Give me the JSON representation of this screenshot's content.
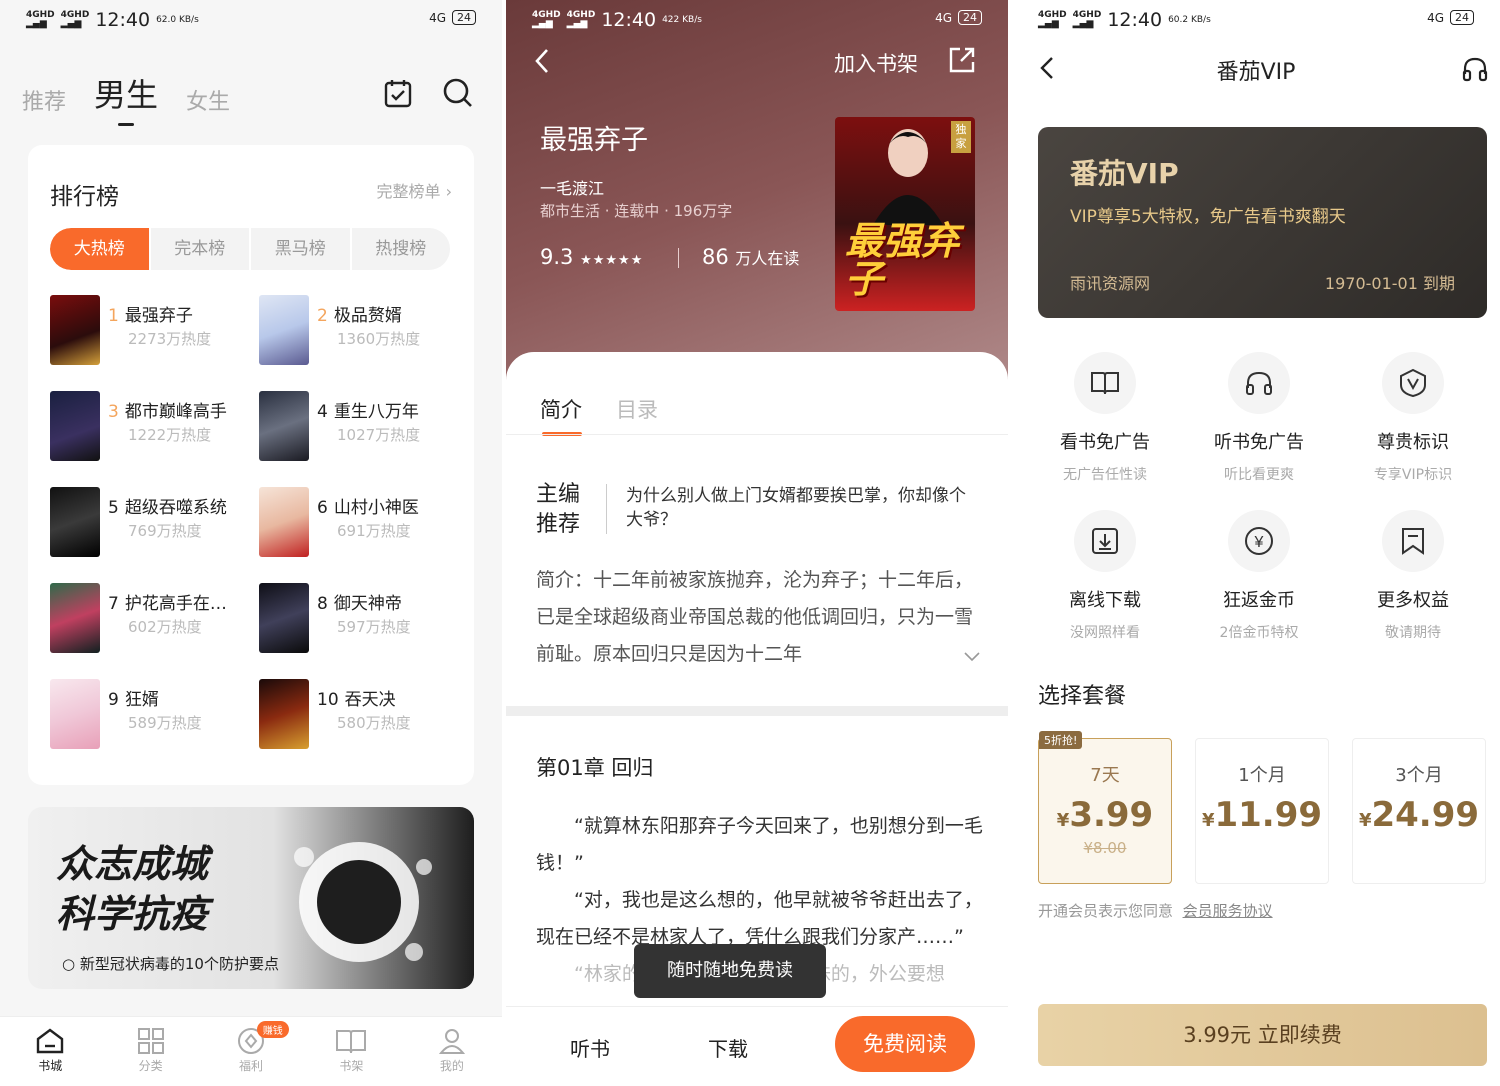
{
  "status_bars": [
    {
      "time": "12:40",
      "speed": "62.0 KB/s",
      "battery": "24",
      "net": "4G"
    },
    {
      "time": "12:40",
      "speed": "422 KB/s",
      "battery": "24",
      "net": "4G"
    },
    {
      "time": "12:40",
      "speed": "60.2 KB/s",
      "battery": "24",
      "net": "4G"
    }
  ],
  "store": {
    "tabs": [
      "推荐",
      "男生",
      "女生"
    ],
    "ranking": {
      "title": "排行榜",
      "more": "完整榜单 ›",
      "segments": [
        "大热榜",
        "完本榜",
        "黑马榜",
        "热搜榜"
      ],
      "items": [
        {
          "num": "1",
          "name": "最强弃子",
          "heat": "2273万热度"
        },
        {
          "num": "2",
          "name": "极品赘婿",
          "heat": "1360万热度"
        },
        {
          "num": "3",
          "name": "都市巅峰高手",
          "heat": "1222万热度"
        },
        {
          "num": "4",
          "name": "重生八万年",
          "heat": "1027万热度"
        },
        {
          "num": "5",
          "name": "超级吞噬系统",
          "heat": "769万热度"
        },
        {
          "num": "6",
          "name": "山村小神医",
          "heat": "691万热度"
        },
        {
          "num": "7",
          "name": "护花高手在…",
          "heat": "602万热度"
        },
        {
          "num": "8",
          "name": "御天神帝",
          "heat": "597万热度"
        },
        {
          "num": "9",
          "name": "狂婿",
          "heat": "589万热度"
        },
        {
          "num": "10",
          "name": "吞天决",
          "heat": "580万热度"
        }
      ]
    },
    "banner": {
      "line1": "众志成城",
      "line2": "科学抗疫",
      "sub": "新型冠状病毒的10个防护要点"
    },
    "tabbar": [
      "书城",
      "分类",
      "福利",
      "书架",
      "我的"
    ],
    "badge": "赚钱"
  },
  "book": {
    "add_shelf": "加入书架",
    "title": "最强弃子",
    "author": "一毛渡江",
    "meta": "都市生活 · 连载中 · 196万字",
    "score": "9.3",
    "stars": "★★★★★",
    "readers": "86",
    "readers_unit": "万人在读",
    "cover_title": "最强弃子",
    "cover_tag": "独家",
    "tabs": [
      "简介",
      "目录"
    ],
    "rec_label": "主编推荐",
    "rec_text": "为什么别人做上门女婿都要挨巴掌，你却像个大爷？",
    "intro": "简介：十二年前被家族抛弃，沦为弃子；十二年后，已是全球超级商业帝国总裁的他低调回归，只为一雪前耻。原本回归只是因为十二年",
    "chapter": "第01章 回归",
    "chapter_p1": "“就算林东阳那弃子今天回来了，也别想分到一毛钱！”",
    "chapter_p2": "“对，我也是这么想的，他早就被爷爷赶出去了，现在已经不是林家人了，凭什么跟我们分家产……”",
    "chapter_p3": "“林家的家产是我们王兄弟姐妹的，外公要想",
    "toast": "随时随地免费读",
    "listen": "听书",
    "download": "下载",
    "read": "免费阅读"
  },
  "vip": {
    "title": "番茄VIP",
    "card_title": "番茄VIP",
    "card_desc": "VIP尊享5大特权，免广告看书爽翻天",
    "card_source": "雨讯资源网",
    "card_expiry": "1970-01-01 到期",
    "perks": [
      {
        "name": "看书免广告",
        "desc": "无广告任性读",
        "icon": "book-icon"
      },
      {
        "name": "听书免广告",
        "desc": "听比看更爽",
        "icon": "headphones-icon"
      },
      {
        "name": "尊贵标识",
        "desc": "专享VIP标识",
        "icon": "vip-shield-icon"
      },
      {
        "name": "离线下载",
        "desc": "没网照样看",
        "icon": "download-icon"
      },
      {
        "name": "狂返金币",
        "desc": "2倍金币特权",
        "icon": "coin-icon"
      },
      {
        "name": "更多权益",
        "desc": "敬请期待",
        "icon": "bookmark-icon"
      }
    ],
    "section": "选择套餐",
    "plans": [
      {
        "term": "7天",
        "price": "3.99",
        "original": "¥8.00",
        "tag": "5折抢!"
      },
      {
        "term": "1个月",
        "price": "11.99"
      },
      {
        "term": "3个月",
        "price": "24.99"
      }
    ],
    "currency": "¥",
    "agree_text": "开通会员表示您同意",
    "agree_link": "会员服务协议",
    "pay_button": "3.99元 立即续费",
    "accent": "#c8a05a"
  },
  "colors": {
    "orange": "#f96a2b",
    "gold": "#8a6a3a"
  }
}
